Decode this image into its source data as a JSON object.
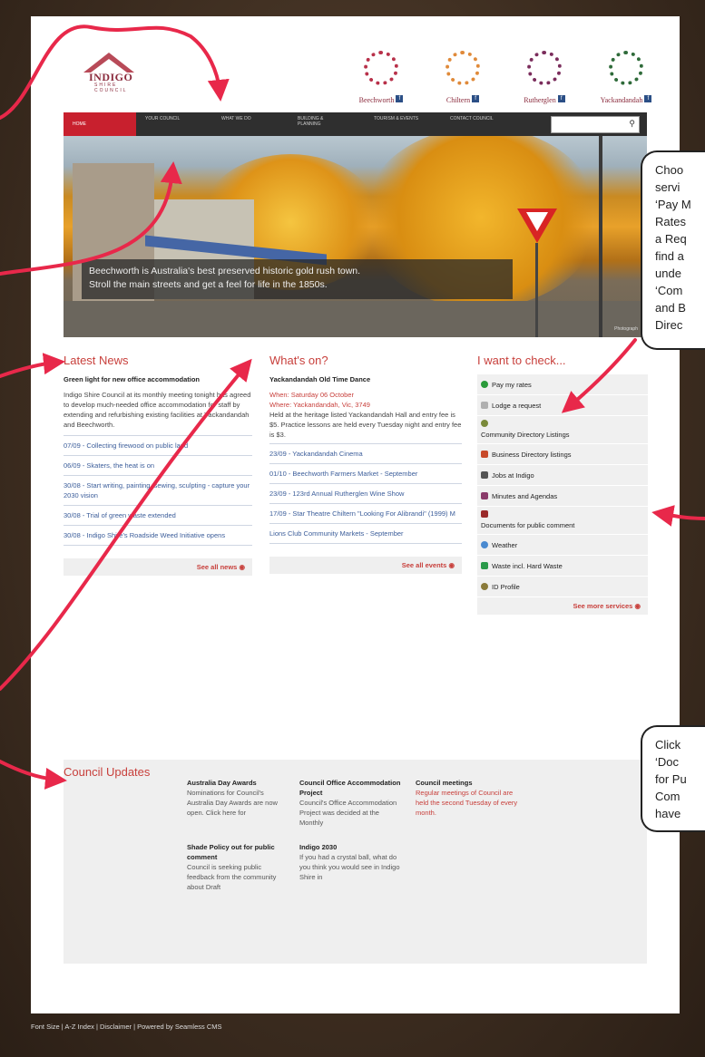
{
  "header": {
    "logo_text": "INDIGO",
    "logo_sub": "SHIRE COUNCIL",
    "towns": [
      {
        "name": "Beechworth",
        "color": "#b8314a"
      },
      {
        "name": "Chiltern",
        "color": "#e08a3a"
      },
      {
        "name": "Rutherglen",
        "color": "#7b2d5c"
      },
      {
        "name": "Yackandandah",
        "color": "#2f6b3a"
      }
    ]
  },
  "nav": {
    "items": [
      "HOME",
      "YOUR COUNCIL",
      "WHAT WE DO",
      "BUILDING & PLANNING",
      "TOURISM & EVENTS",
      "CONTACT COUNCIL"
    ],
    "search_placeholder": ""
  },
  "hero": {
    "caption_line1": "Beechworth is Australia's best preserved historic gold rush town.",
    "caption_line2": "Stroll the main streets and get a feel for life in the 1850s.",
    "credit": "Photograph"
  },
  "news": {
    "title": "Latest News",
    "headline": "Green light for new office accommodation",
    "body": "Indigo Shire Council at its monthly meeting tonight has agreed to develop much-needed office accommodation for staff by extending and refurbishing existing facilities at Yackandandah and Beechworth.",
    "items": [
      "07/09 - Collecting firewood on public land",
      "06/09 - Skaters, the heat is on",
      "30/08 - Start writing, painting, sewing, sculpting - capture your 2030 vision",
      "30/08 - Trial of green waste extended",
      "30/08 - Indigo Shire's Roadside Weed Initiative opens"
    ],
    "see_all": "See all news"
  },
  "events": {
    "title": "What's on?",
    "headline": "Yackandandah Old Time Dance",
    "when": "When: Saturday 06 October",
    "where": "Where: Yackandandah, Vic, 3749",
    "body": "Held at the heritage listed Yackandandah Hall and entry fee is $5. Practice lessons are held every Tuesday night and entry fee is $3.",
    "items": [
      "23/09 - Yackandandah Cinema",
      "01/10 - Beechworth Farmers Market - September",
      "23/09 - 123rd Annual Rutherglen Wine Show",
      "17/09 - Star Theatre Chiltern \"Looking For Alibrandi\" (1999) M",
      "Lions Club Community Markets - September"
    ],
    "see_all": "See all events"
  },
  "checks": {
    "title": "I want to check...",
    "items": [
      {
        "label": "Pay my rates",
        "color": "#2a9a3a"
      },
      {
        "label": "Lodge a request",
        "color": "#b0b0b0"
      },
      {
        "label": "Community Directory Listings",
        "color": "#7a8a3a"
      },
      {
        "label": "Business Directory listings",
        "color": "#c84a2a"
      },
      {
        "label": "Jobs at Indigo",
        "color": "#555555"
      },
      {
        "label": "Minutes and Agendas",
        "color": "#8a3a6a"
      },
      {
        "label": "Documents for public comment",
        "color": "#9a2a2a"
      },
      {
        "label": "Weather",
        "color": "#4a8ad0"
      },
      {
        "label": "Waste incl. Hard Waste",
        "color": "#2a9a4a"
      },
      {
        "label": "ID Profile",
        "color": "#8a7a3a"
      }
    ],
    "see_more": "See more services"
  },
  "updates": {
    "title": "Council Updates",
    "items": [
      {
        "head": "Australia Day Awards",
        "body": "Nominations for Council's Australia Day Awards are now open. Click here for"
      },
      {
        "head": "Council Office Accommodation Project",
        "body": "Council's Office Accommodation Project was decided at the Monthly"
      },
      {
        "head": "Council meetings",
        "body": "Regular meetings of Council are held the second Tuesday of every month."
      },
      {
        "head": "Shade Policy out for public comment",
        "body": "Council is seeking public feedback from the community about Draft"
      },
      {
        "head": "Indigo 2030",
        "body": "If you had a crystal ball, what do you think you would see in Indigo Shire in"
      }
    ]
  },
  "footer": {
    "text": "Font Size  |  A-Z Index  |  Disclaimer  |  Powered by Seamless CMS"
  },
  "callouts": {
    "one": [
      "Choo",
      "servi",
      "‘Pay M",
      "Rates",
      "a Req",
      "find a",
      "unde",
      "‘Com",
      "and B",
      "Direc"
    ],
    "two": [
      "Click",
      "‘Doc",
      "for Pu",
      "Com",
      "have"
    ]
  }
}
